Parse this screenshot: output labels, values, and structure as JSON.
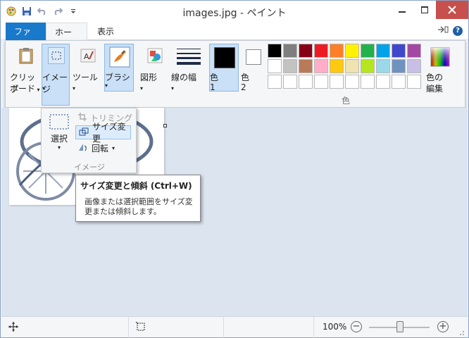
{
  "title": "images.jpg - ペイント",
  "tabs": {
    "file": "ファイル",
    "home": "ホーム",
    "view": "表示"
  },
  "groups": {
    "clipboard": {
      "line1": "クリップ",
      "line2": "ボード"
    },
    "image": "イメージ",
    "tools": "ツール",
    "brush": "ブラシ",
    "shapes": "図形",
    "line_width": "線の幅",
    "color1": {
      "label": "色",
      "num": "1"
    },
    "color2": {
      "label": "色",
      "num": "2"
    },
    "colors_group_label": "色",
    "edit_colors": {
      "line1": "色の",
      "line2": "編集"
    }
  },
  "palette": {
    "row1": [
      "#000000",
      "#7f7f7f",
      "#880015",
      "#ed1c24",
      "#ff7f27",
      "#fff200",
      "#22b14c",
      "#00a2e8",
      "#3f48cc",
      "#a349a4"
    ],
    "row2": [
      "#ffffff",
      "#c3c3c3",
      "#b97a57",
      "#ffaec9",
      "#ffc90e",
      "#efe4b0",
      "#b5e61d",
      "#99d9ea",
      "#7092be",
      "#c8bfe7"
    ],
    "row3": [
      "#ffffff",
      "#ffffff",
      "#ffffff",
      "#ffffff",
      "#ffffff",
      "#ffffff",
      "#ffffff",
      "#ffffff",
      "#ffffff",
      "#ffffff"
    ],
    "primary": "#000000",
    "secondary": "#ffffff"
  },
  "dropdown": {
    "select": "選択",
    "trim": "トリミング",
    "resize": "サイズ変更",
    "rotate": "回転",
    "group_label": "イメージ"
  },
  "tooltip": {
    "title": "サイズ変更と傾斜 (Ctrl+W)",
    "body1": "画像または選択範囲をサイズ変",
    "body2": "更または傾斜します。"
  },
  "status": {
    "zoom": "100%"
  }
}
